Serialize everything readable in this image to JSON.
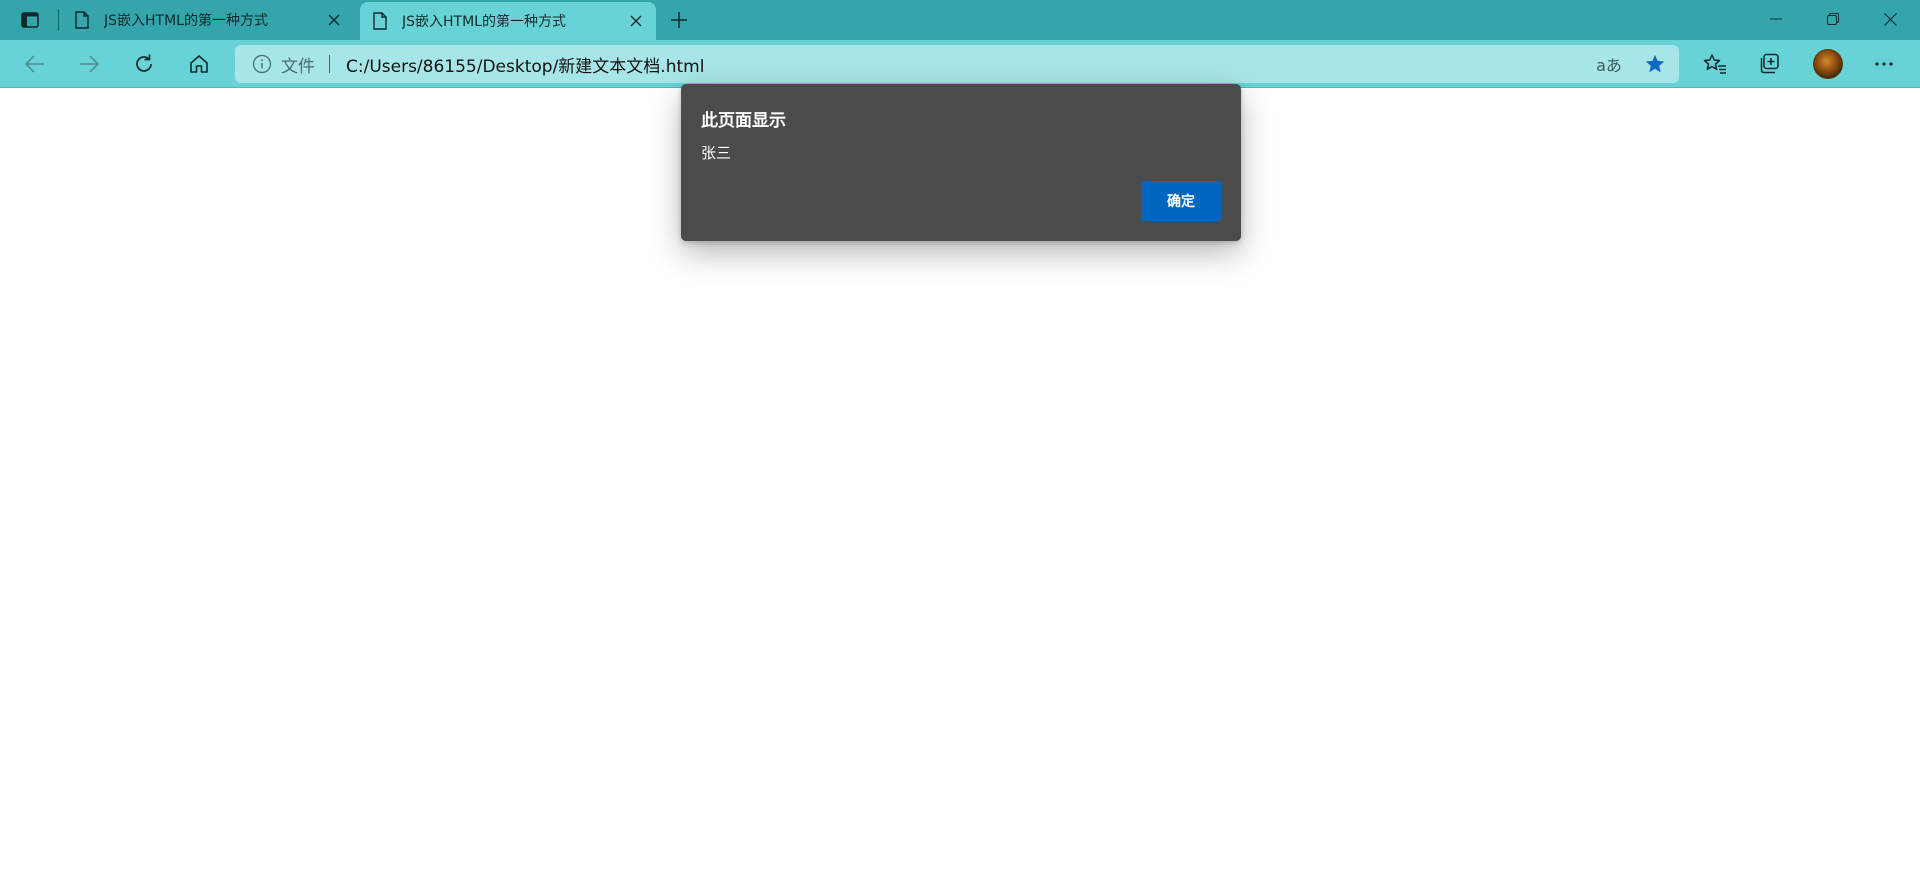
{
  "browser": {
    "tabs": [
      {
        "title": "JS嵌入HTML的第一种方式",
        "active": false
      },
      {
        "title": "JS嵌入HTML的第一种方式",
        "active": true
      }
    ],
    "address_bar": {
      "scheme_label": "文件",
      "url": "C:/Users/86155/Desktop/新建文本文档.html"
    },
    "read_aloud_glyph": "aあ",
    "colors": {
      "tabstrip": "#33a5ab",
      "toolbar": "#68d3d6",
      "address_bar": "#a7e6e8",
      "favorite_star": "#1269c4"
    },
    "icons": [
      "tab-actions-icon",
      "page-icon",
      "close-icon",
      "plus-icon",
      "minimize-icon",
      "restore-icon",
      "back-icon",
      "forward-icon",
      "refresh-icon",
      "home-icon",
      "info-icon",
      "star-icon",
      "favorites-icon",
      "collections-icon",
      "more-icon"
    ]
  },
  "dialog": {
    "title": "此页面显示",
    "message": "张三",
    "ok_label": "确定",
    "colors": {
      "background": "#4b4b4b",
      "ok_button": "#0067c0"
    }
  }
}
